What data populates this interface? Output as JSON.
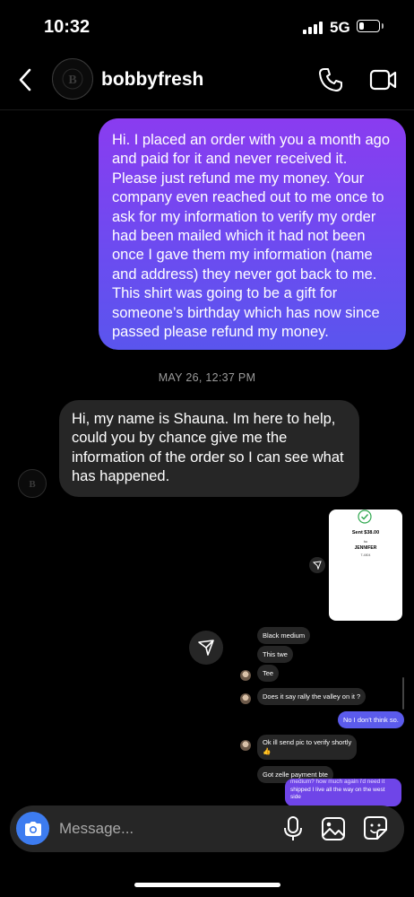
{
  "status_bar": {
    "time": "10:32",
    "network": "5G",
    "battery_level": 0.25
  },
  "header": {
    "username": "bobbyfresh",
    "avatar_initials": "B"
  },
  "messages": {
    "outgoing_1": "Hi. I placed an order with you a month ago and paid for it and never received it. Please just refund me my money. Your company even reached out to me once to ask for my information to verify my order had been mailed which it had not been once I gave them my information (name and address) they never got back to me. This shirt was going to be a gift for someone’s birthday which has now since passed please refund my money.",
    "timestamp": "MAY 26, 12:37 PM",
    "incoming_1": "Hi, my name is Shauna. Im here to help, could you by chance give me the information of the order so I can see what has happened."
  },
  "shared_image": {
    "sent_text": "Sent $38.00",
    "to_text": "to",
    "recipient": "JENNIFER",
    "account": "T-4804"
  },
  "mini_chat": {
    "m1": "Black medium",
    "m2": "This twe",
    "m3": "Tee",
    "m4": "Does it say rally the valley on it ?",
    "m5": "No I don't think so.",
    "m6": "Ok ill send pic to verify shortly",
    "m6_emoji": "👍",
    "m7": "Got zelle payment bte",
    "m8_cut": "medium? how much again i'd need it",
    "m8": "shipped I live all the way on the west side"
  },
  "composer": {
    "placeholder": "Message..."
  },
  "colors": {
    "outgoing_bubble": "#8a3cf0",
    "incoming_bubble": "#262626",
    "camera_button": "#3d7cf0"
  }
}
